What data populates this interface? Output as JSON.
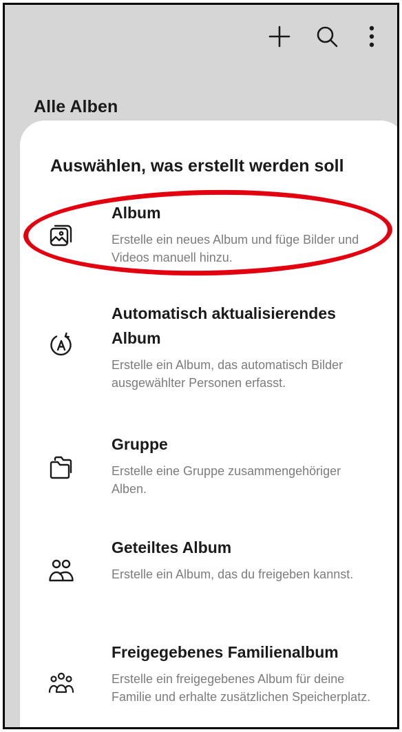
{
  "header": {
    "title": "Alle Alben",
    "actions": [
      {
        "icon": "plus-icon"
      },
      {
        "icon": "search-icon"
      },
      {
        "icon": "more-vertical-icon"
      }
    ]
  },
  "sheet": {
    "title": "Auswählen, was erstellt werden soll",
    "options": [
      {
        "icon": "album-icon",
        "title": "Album",
        "description": "Erstelle ein neues Album und füge Bilder und Videos manuell hinzu."
      },
      {
        "icon": "auto-update-album-icon",
        "title": "Automatisch aktualisierendes Album",
        "description": "Erstelle ein Album, das automatisch Bilder ausgewählter Personen erfasst."
      },
      {
        "icon": "folder-group-icon",
        "title": "Gruppe",
        "description": "Erstelle eine Gruppe zusammengehöriger Alben."
      },
      {
        "icon": "shared-album-icon",
        "title": "Geteiltes Album",
        "description": "Erstelle ein Album, das du freigeben kannst."
      },
      {
        "icon": "family-album-icon",
        "title": "Freigegebenes Familienalbum",
        "description": "Erstelle ein freigegebenes Album für deine Familie und erhalte zusätzlichen Speicherplatz."
      }
    ]
  },
  "colors": {
    "background": "#d6d6d6",
    "sheet": "#ffffff",
    "title_text": "#1a1a1a",
    "secondary_text": "#7c7c7c",
    "highlight": "#e3000f"
  }
}
